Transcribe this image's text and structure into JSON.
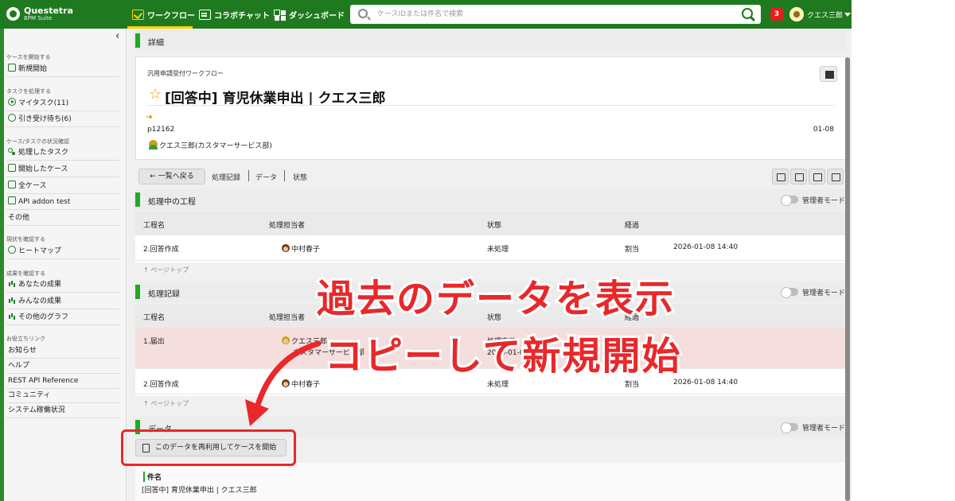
{
  "app": {
    "logo_line1": "Questetra",
    "logo_line2": "BPM Suite"
  },
  "nav": {
    "workflow": "ワークフロー",
    "chat": "コラボチャット",
    "dashboard": "ダッシュボード"
  },
  "search": {
    "placeholder": "ケースIDまたは件名で検索"
  },
  "notifications": "3",
  "user": {
    "name": "クエス三郎"
  },
  "sidebar": {
    "sections": [
      {
        "heading": "ケースを開始する",
        "items": [
          "新規開始"
        ]
      },
      {
        "heading": "タスクを処理する",
        "items": [
          "マイタスク(11)",
          "引き受け待ち(6)"
        ]
      },
      {
        "heading": "ケース/タスクの状況確認",
        "items": [
          "処理したタスク",
          "開始したケース",
          "全ケース",
          "API addon test",
          "その他"
        ]
      },
      {
        "heading": "現状を確認する",
        "items": [
          "ヒートマップ"
        ]
      },
      {
        "heading": "成果を確認する",
        "items": [
          "あなたの成果",
          "みんなの成果",
          "その他のグラフ"
        ]
      },
      {
        "heading": "お役立ちリンク",
        "items": [
          "お知らせ",
          "ヘルプ",
          "REST API Reference",
          "コミュニティ",
          "システム稼働状況"
        ]
      }
    ]
  },
  "detail": {
    "section_title": "詳細",
    "workflow_name": "汎用申請受付ワークフロー",
    "case_title": "[回答中] 育児休業申出 | クエス三郎",
    "process_id": "p12162",
    "date": "01-08",
    "starter": "クエス三郎(カスタマーサービス部)"
  },
  "toolbar": {
    "back": "← 一覧へ戻る",
    "tabs": [
      "処理記録",
      "データ",
      "状態"
    ]
  },
  "current": {
    "title": "処理中の工程",
    "admin_mode": "管理者モード",
    "headers": [
      "工程名",
      "処理担当者",
      "状態",
      "経過"
    ],
    "rows": [
      {
        "step": "2.回答作成",
        "assignee": "中村春子",
        "status": "未処理",
        "elapsed": "割当",
        "time": "2026-01-08 14:40"
      }
    ],
    "pagetop": "↑ ページトップ"
  },
  "history": {
    "title": "処理記録",
    "admin_mode": "管理者モード",
    "headers": [
      "工程名",
      "処理担当者",
      "状態",
      "経過"
    ],
    "rows": [
      {
        "step": "1.届出",
        "assignee": "クエス三郎",
        "assignee_dept": "カスタマーサービス部",
        "status": "処理完了",
        "status_detail": "2026-01-08 14:40 (0 分)"
      },
      {
        "step": "2.回答作成",
        "assignee": "中村春子",
        "status": "未処理",
        "elapsed": "割当",
        "time": "2026-01-08 14:40"
      }
    ],
    "pagetop": "↑ ページトップ"
  },
  "data_section": {
    "title": "データ",
    "admin_mode": "管理者モード",
    "reuse_button": "このデータを再利用してケースを開始",
    "field_label": "件名",
    "field_value": "[回答中] 育児休業申出 | クエス三郎"
  },
  "overlay": {
    "line1": "過去のデータを表示",
    "line2": "コピーして新規開始",
    "color": "#e8282a"
  }
}
